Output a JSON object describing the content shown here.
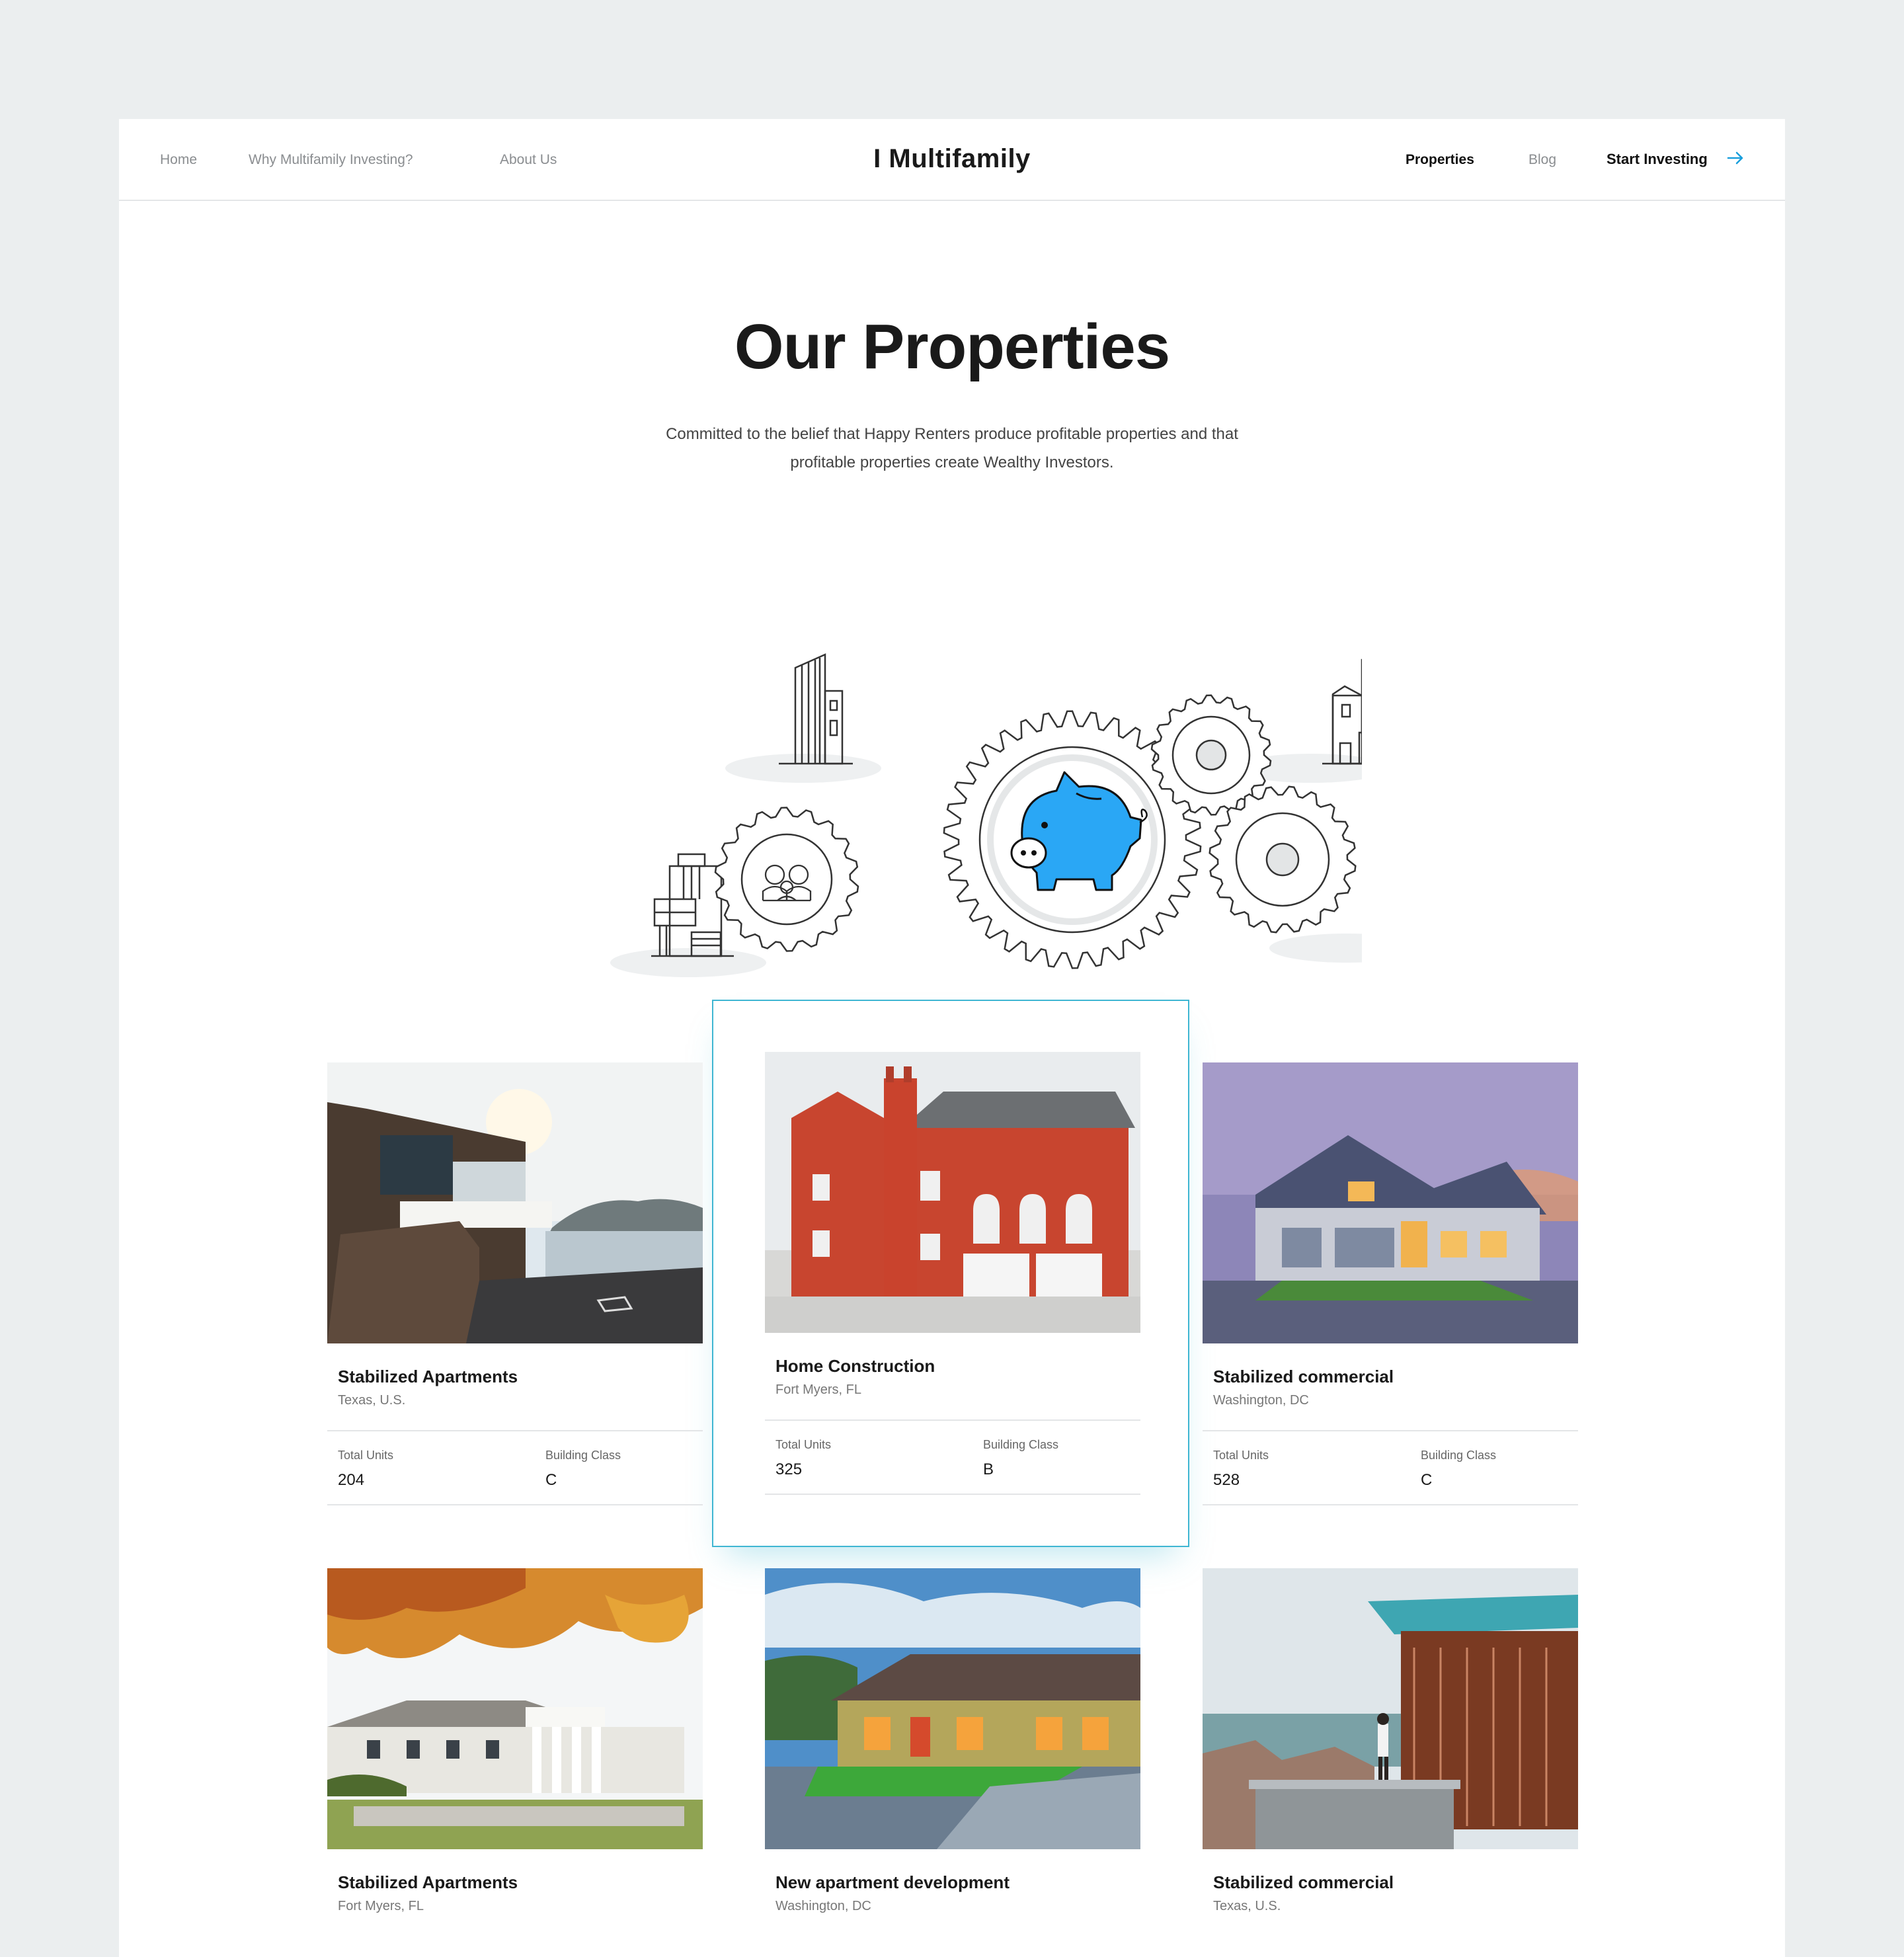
{
  "nav": {
    "left": [
      "Home",
      "Why Multifamily Investing?",
      "About Us"
    ],
    "logo": "I Multifamily",
    "right": [
      "Properties",
      "Blog"
    ],
    "cta": "Start Investing",
    "active": "Properties"
  },
  "hero": {
    "title": "Our Properties",
    "subtitle_line1": "Committed to the belief that Happy Renters produce profitable properties and that",
    "subtitle_line2": "profitable properties create Wealthy Investors."
  },
  "cards": [
    {
      "title": "Stabilized Apartments",
      "location": "Texas, U.S.",
      "units_label": "Total Units",
      "units": "204",
      "class_label": "Building Class",
      "class": "C"
    },
    {
      "title": "Home Construction",
      "location": "Fort Myers, FL",
      "units_label": "Total Units",
      "units": "325",
      "class_label": "Building Class",
      "class": "B"
    },
    {
      "title": "Stabilized commercial",
      "location": "Washington, DC",
      "units_label": "Total Units",
      "units": "528",
      "class_label": "Building Class",
      "class": "C"
    },
    {
      "title": "Stabilized Apartments",
      "location": "Fort Myers, FL"
    },
    {
      "title": "New apartment development",
      "location": "Washington, DC"
    },
    {
      "title": "Stabilized commercial",
      "location": "Texas, U.S."
    }
  ],
  "colors": {
    "accent": "#1a9fdc",
    "highlight_border": "#3fb6d2",
    "piggy": "#2aa7f5"
  }
}
